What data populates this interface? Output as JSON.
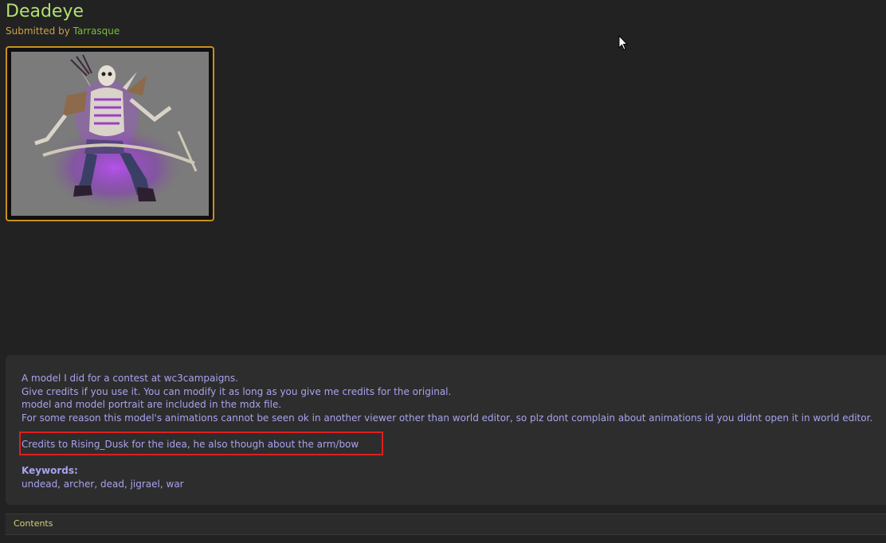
{
  "resource": {
    "title": "Deadeye",
    "submitted_prefix": "Submitted by",
    "author": "Tarrasque"
  },
  "thumbnail": {
    "alt": "Deadeye model preview",
    "frame_color": "#c8911b"
  },
  "description": {
    "lines": [
      "A model I did for a contest at wc3campaigns.",
      "Give credits if you use it. You can modify it as long as you give me credits for the original.",
      "model and model portrait are included in the mdx file.",
      "For some reason this model's animations cannot be seen ok in another viewer other than world editor, so plz dont complain about animations id you didnt open it in world editor."
    ],
    "credits": "Credits to Rising_Dusk for the idea, he also though about the arm/bow",
    "keywords_label": "Keywords:",
    "keywords": "undead, archer, dead, jigrael, war"
  },
  "contents": {
    "label": "Contents"
  },
  "colors": {
    "title": "#b2e070",
    "text": "#a8a3ee",
    "highlight": "#e11d1d",
    "background": "#222222",
    "panel": "#2d2d2d"
  }
}
